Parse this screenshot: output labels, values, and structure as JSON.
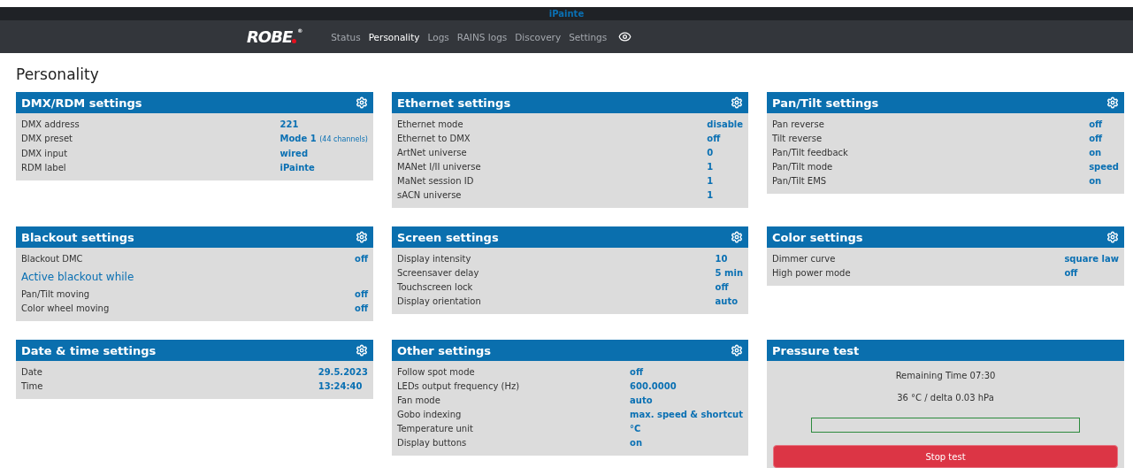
{
  "device_bar": {
    "name": "iPainte"
  },
  "nav": {
    "logo": "ROBE",
    "logo_mark": "®",
    "items": [
      {
        "label": "Status",
        "selected": false
      },
      {
        "label": "Personality",
        "selected": true
      },
      {
        "label": "Logs",
        "selected": false
      },
      {
        "label": "RAINS logs",
        "selected": false
      },
      {
        "label": "Discovery",
        "selected": false
      },
      {
        "label": "Settings",
        "selected": false
      }
    ]
  },
  "page_title": "Personality",
  "panels": [
    {
      "title": "DMX/RDM settings",
      "rows": [
        {
          "kind": "setting",
          "label": "DMX address",
          "value": "221"
        },
        {
          "kind": "setting",
          "label": "DMX preset",
          "value": "Mode 1",
          "note": "(44 channels)"
        },
        {
          "kind": "setting",
          "label": "DMX input",
          "value": "wired"
        },
        {
          "kind": "setting",
          "label": "RDM label",
          "value": "iPainte"
        }
      ]
    },
    {
      "title": "Ethernet settings",
      "rows": [
        {
          "kind": "setting",
          "label": "Ethernet mode",
          "value": "disable"
        },
        {
          "kind": "setting",
          "label": "Ethernet to DMX",
          "value": "off"
        },
        {
          "kind": "setting",
          "label": "ArtNet universe",
          "value": "0"
        },
        {
          "kind": "setting",
          "label": "MANet I/II universe",
          "value": "1"
        },
        {
          "kind": "setting",
          "label": "MaNet session ID",
          "value": "1"
        },
        {
          "kind": "setting",
          "label": "sACN universe",
          "value": "1"
        }
      ]
    },
    {
      "title": "Pan/Tilt settings",
      "rows": [
        {
          "kind": "setting",
          "label": "Pan reverse",
          "value": "off"
        },
        {
          "kind": "setting",
          "label": "Tilt reverse",
          "value": "off"
        },
        {
          "kind": "setting",
          "label": "Pan/Tilt feedback",
          "value": "on"
        },
        {
          "kind": "setting",
          "label": "Pan/Tilt mode",
          "value": "speed"
        },
        {
          "kind": "setting",
          "label": "Pan/Tilt EMS",
          "value": "on"
        }
      ]
    },
    {
      "title": "Blackout settings",
      "rows": [
        {
          "kind": "setting",
          "label": "Blackout DMC",
          "value": "off"
        },
        {
          "kind": "subheading",
          "label": "Active blackout while"
        },
        {
          "kind": "setting",
          "label": "Pan/Tilt moving",
          "value": "off"
        },
        {
          "kind": "setting",
          "label": "Color wheel moving",
          "value": "off"
        }
      ]
    },
    {
      "title": "Screen settings",
      "rows": [
        {
          "kind": "setting",
          "label": "Display intensity",
          "value": "10"
        },
        {
          "kind": "setting",
          "label": "Screensaver delay",
          "value": "5 min"
        },
        {
          "kind": "setting",
          "label": "Touchscreen lock",
          "value": "off"
        },
        {
          "kind": "setting",
          "label": "Display orientation",
          "value": "auto"
        }
      ]
    },
    {
      "title": "Color settings",
      "rows": [
        {
          "kind": "setting",
          "label": "Dimmer curve",
          "value": "square law"
        },
        {
          "kind": "setting",
          "label": "High power mode",
          "value": "off"
        }
      ]
    },
    {
      "title": "Date & time settings",
      "rows": [
        {
          "kind": "setting",
          "label": "Date",
          "value": "29.5.2023"
        },
        {
          "kind": "setting",
          "label": "Time",
          "value": "13:24:40"
        }
      ]
    },
    {
      "title": "Other settings",
      "rows": [
        {
          "kind": "setting",
          "label": "Follow spot mode",
          "value": "off"
        },
        {
          "kind": "setting",
          "label": "LEDs output frequency (Hz)",
          "value": "600.0000"
        },
        {
          "kind": "setting",
          "label": "Fan mode",
          "value": "auto"
        },
        {
          "kind": "setting",
          "label": "Gobo indexing",
          "value": "max. speed & shortcut"
        },
        {
          "kind": "setting",
          "label": "Temperature unit",
          "value": "°C"
        },
        {
          "kind": "setting",
          "label": "Display buttons",
          "value": "on"
        }
      ]
    }
  ],
  "pressure_test": {
    "title": "Pressure test",
    "remaining": "Remaining Time 07:30",
    "reading": "36 °C / delta 0.03 hPa",
    "progress": {
      "level": 0
    },
    "button": "Stop test"
  }
}
